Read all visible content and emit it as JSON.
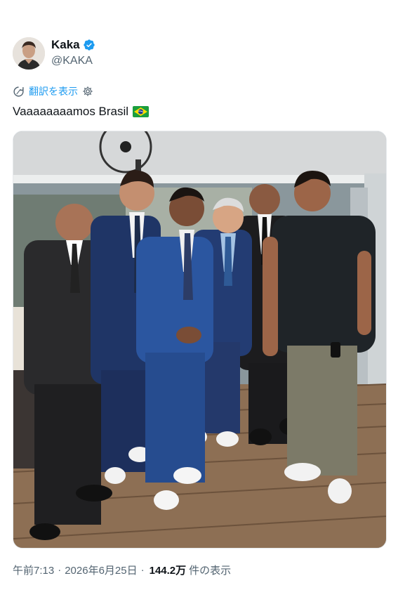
{
  "author": {
    "display_name": "Kaka",
    "handle": "@KAKA",
    "verified": true,
    "avatar_icon": "profile-photo"
  },
  "translate": {
    "label": "翻訳を表示",
    "icon": "translate-icon",
    "settings_icon": "gear-icon"
  },
  "tweet": {
    "text": "Vaaaaaaaamos Brasil",
    "emoji": "brazil-flag-emoji"
  },
  "photo": {
    "description_icon": "group-photo"
  },
  "meta": {
    "time": "午前7:13",
    "dot1": "·",
    "date": "2026年6月25日",
    "dot2": "·",
    "views": "144.2万",
    "views_label": "件の表示"
  },
  "colors": {
    "link": "#1d9bf0",
    "verified": "#1d9bf0",
    "secondary_text": "#536471",
    "primary_text": "#0f1419"
  }
}
